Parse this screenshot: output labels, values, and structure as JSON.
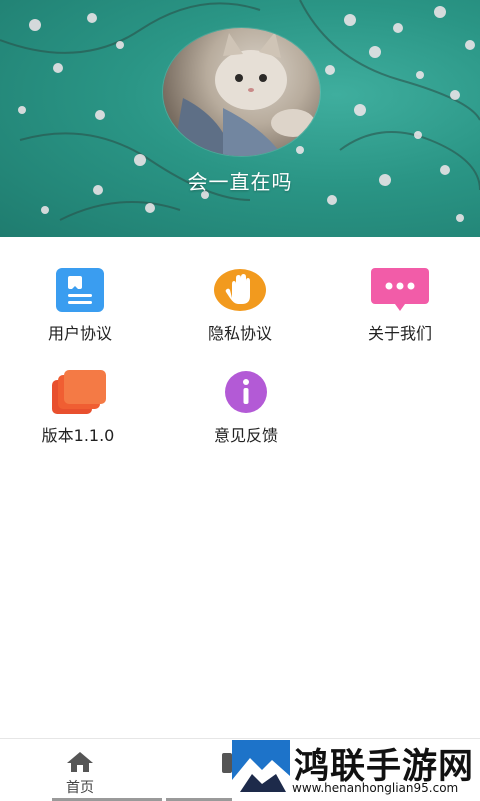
{
  "profile": {
    "nickname": "会一直在吗"
  },
  "menu": {
    "items": [
      {
        "label": "用户协议",
        "icon": "document-icon",
        "color": "#3a9df0"
      },
      {
        "label": "隐私协议",
        "icon": "hand-icon",
        "color": "#f29a1e"
      },
      {
        "label": "关于我们",
        "icon": "chat-bubble-icon",
        "color": "#f25ca8"
      },
      {
        "label": "版本1.1.0",
        "icon": "cards-icon",
        "color": "#f36b3b"
      },
      {
        "label": "意见反馈",
        "icon": "info-icon",
        "color": "#b35ad6"
      }
    ]
  },
  "bottom_nav": {
    "tabs": [
      {
        "label": "首页",
        "icon": "home-icon"
      }
    ]
  },
  "watermark": {
    "title": "鸿联手游网",
    "url": "www.henanhonglian95.com"
  }
}
